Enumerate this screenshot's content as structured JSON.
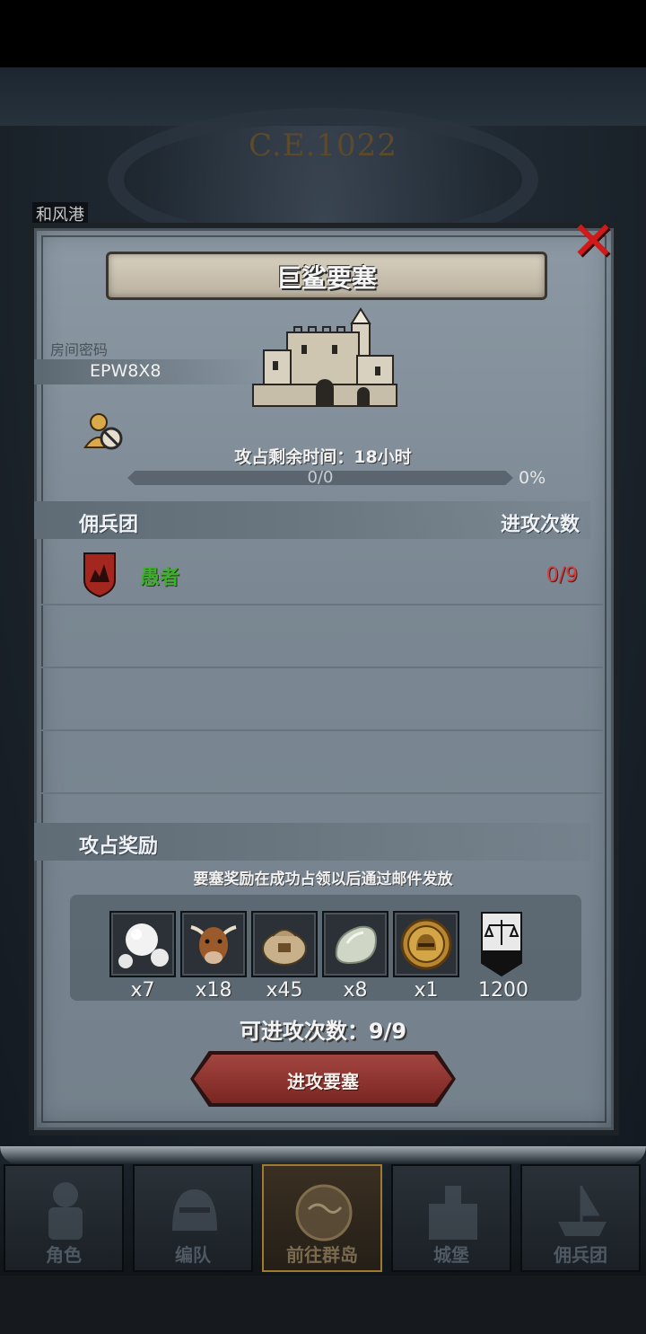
{
  "header": {
    "era_date": "C.E.1022",
    "port_name": "和风港"
  },
  "dialog": {
    "title": "巨鲨要塞",
    "room_label": "房间密码",
    "room_code": "EPW8X8",
    "time_remaining": "攻占剩余时间：18小时",
    "progress": {
      "text": "0/0",
      "percent_label": "0%",
      "fraction": 0
    }
  },
  "mercenary_section": {
    "left_header": "佣兵团",
    "right_header": "进攻次数",
    "rows": [
      {
        "name": "愚者",
        "count": "0/9"
      }
    ]
  },
  "reward_section": {
    "header": "攻占奖励",
    "note": "要塞奖励在成功占领以后通过邮件发放",
    "items": [
      {
        "icon": "pearl-icon",
        "count": "x7"
      },
      {
        "icon": "cow-icon",
        "count": "x18"
      },
      {
        "icon": "sack-icon",
        "count": "x45"
      },
      {
        "icon": "stone-icon",
        "count": "x8"
      },
      {
        "icon": "helmet-coin-icon",
        "count": "x1"
      },
      {
        "icon": "justice-flag-icon",
        "count": "1200"
      }
    ]
  },
  "attack": {
    "remaining": "可进攻次数：9/9",
    "button_label": "进攻要塞"
  },
  "nav": {
    "items": [
      {
        "label": "角色"
      },
      {
        "label": "编队"
      },
      {
        "label": "前往群岛"
      },
      {
        "label": "城堡"
      },
      {
        "label": "佣兵团"
      }
    ]
  },
  "colors": {
    "merc_name": "#3fae2f",
    "attack_count": "#d23f3f",
    "close": "#d01a1a",
    "button": "#8e3430"
  }
}
